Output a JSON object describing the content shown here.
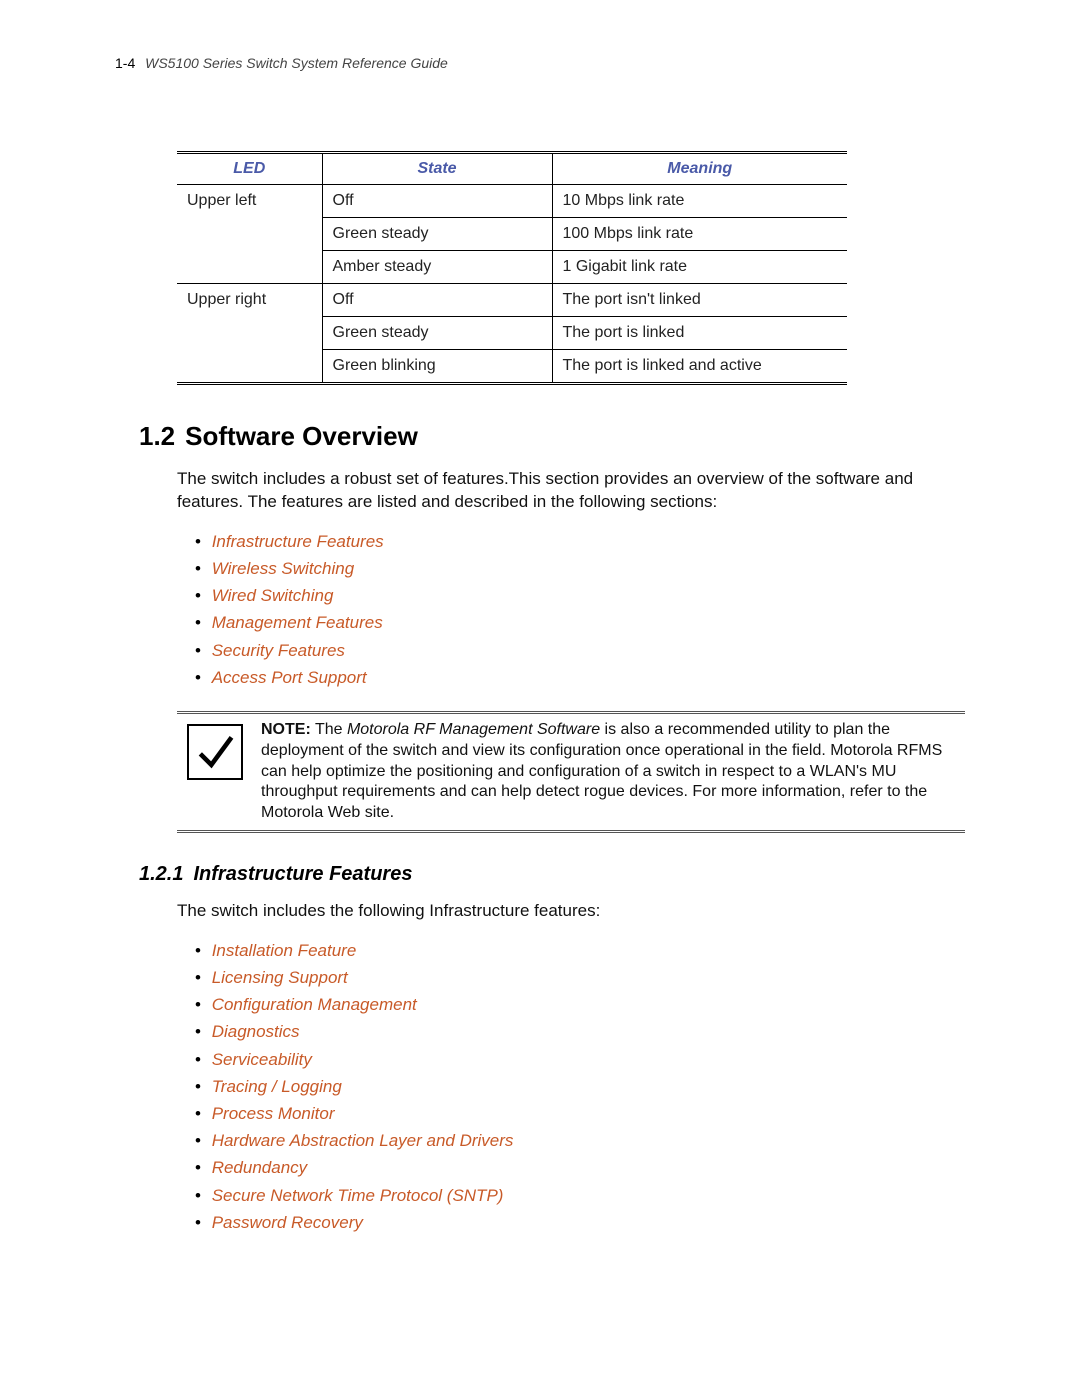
{
  "header": {
    "page_number": "1-4",
    "doc_title": "WS5100 Series Switch System Reference Guide"
  },
  "table": {
    "headers": {
      "led": "LED",
      "state": "State",
      "meaning": "Meaning"
    },
    "rows": [
      {
        "led": "Upper left",
        "state": "Off",
        "meaning": "10 Mbps link rate"
      },
      {
        "led": "",
        "state": "Green steady",
        "meaning": "100 Mbps link rate"
      },
      {
        "led": "",
        "state": "Amber steady",
        "meaning": "1 Gigabit link rate"
      },
      {
        "led": "Upper right",
        "state": "Off",
        "meaning": "The port isn't linked"
      },
      {
        "led": "",
        "state": "Green steady",
        "meaning": "The port is linked"
      },
      {
        "led": "",
        "state": "Green blinking",
        "meaning": "The port is linked and active"
      }
    ]
  },
  "sec12": {
    "number": "1.2",
    "title": "Software Overview",
    "intro": "The switch includes a robust set of features.This section provides an overview of the software and features. The features are listed and described in the following sections:",
    "links": [
      "Infrastructure Features",
      "Wireless Switching",
      "Wired Switching",
      "Management Features",
      "Security Features",
      "Access Port Support"
    ]
  },
  "note": {
    "lead": "NOTE:",
    "text_before_em": " The ",
    "em": "Motorola RF Management Software",
    "text_after_em": " is also a recommended utility to plan the deployment of the switch and view its configuration once operational in the field. Motorola RFMS can help optimize the positioning and configuration of a switch in respect to a WLAN's MU throughput requirements and can help detect rogue devices. For more information, refer to the Motorola Web site."
  },
  "sec121": {
    "number": "1.2.1",
    "title": "Infrastructure Features",
    "intro": "The switch includes the following Infrastructure features:",
    "links": [
      "Installation Feature",
      "Licensing Support",
      "Configuration Management",
      "Diagnostics",
      "Serviceability",
      "Tracing / Logging",
      "Process Monitor",
      "Hardware Abstraction Layer and Drivers",
      "Redundancy",
      "Secure Network Time Protocol (SNTP)",
      "Password Recovery"
    ]
  }
}
